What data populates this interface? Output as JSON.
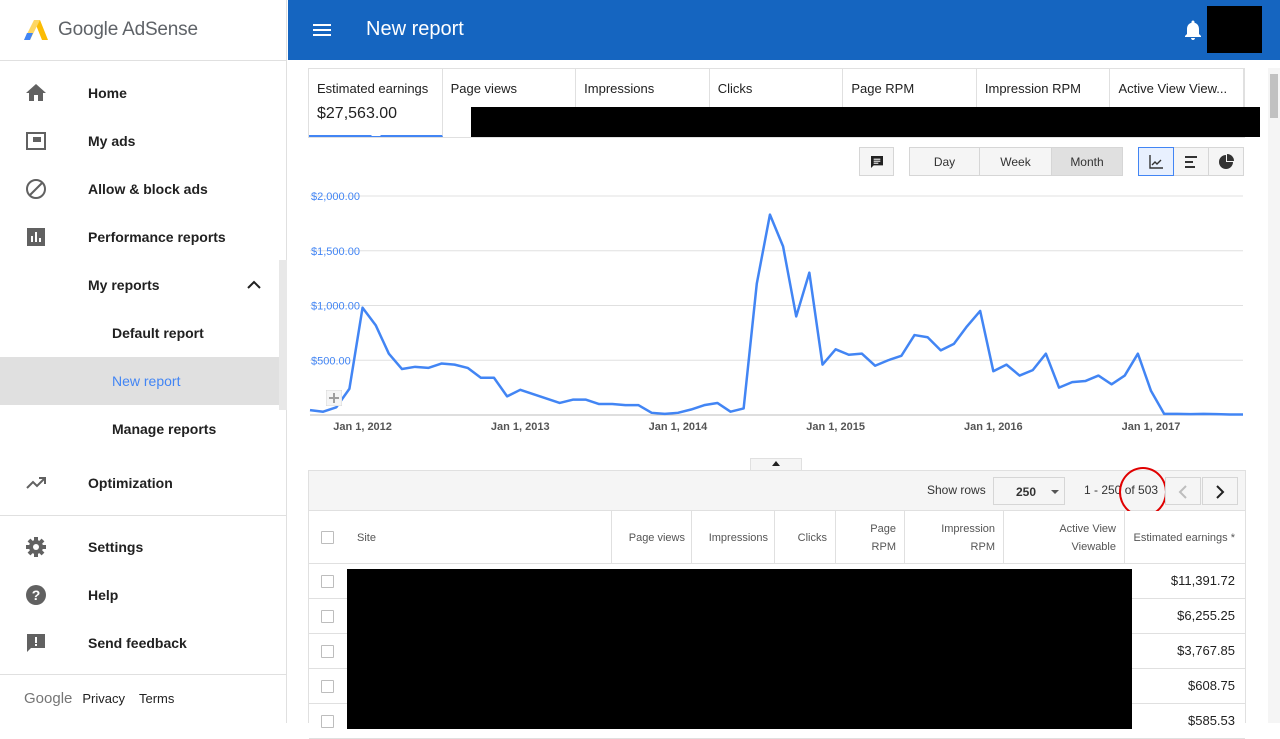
{
  "app": {
    "brand": "Google AdSense",
    "page_title": "New report",
    "colors": {
      "header": "#1565c0",
      "accent": "#4285f4",
      "active_nav_bg": "#e0e0e0"
    }
  },
  "sidebar": {
    "items": [
      {
        "label": "Home",
        "icon": "home-icon"
      },
      {
        "label": "My ads",
        "icon": "ad-unit-icon"
      },
      {
        "label": "Allow & block ads",
        "icon": "block-icon"
      },
      {
        "label": "Performance reports",
        "icon": "bar-chart-icon"
      },
      {
        "label": "My reports",
        "icon": "chevron-up-icon"
      },
      {
        "label": "Default report"
      },
      {
        "label": "New report",
        "active": true
      },
      {
        "label": "Manage reports"
      },
      {
        "label": "Optimization",
        "icon": "trending-up-icon"
      },
      {
        "label": "Settings",
        "icon": "gear-icon"
      },
      {
        "label": "Help",
        "icon": "help-icon"
      },
      {
        "label": "Send feedback",
        "icon": "feedback-icon"
      }
    ],
    "footer": {
      "google": "Google",
      "privacy": "Privacy",
      "terms": "Terms"
    }
  },
  "metrics": [
    {
      "label": "Estimated earnings",
      "value": "$27,563.00",
      "active": true
    },
    {
      "label": "Page views"
    },
    {
      "label": "Impressions"
    },
    {
      "label": "Clicks"
    },
    {
      "label": "Page RPM"
    },
    {
      "label": "Impression RPM"
    },
    {
      "label": "Active View View..."
    }
  ],
  "toolbar": {
    "comment_icon": "comment-icon",
    "periods": [
      "Day",
      "Week",
      "Month"
    ],
    "selected_period": "Month",
    "view_icons": [
      "line-chart-icon",
      "bar-chart-icon",
      "pie-chart-icon"
    ],
    "selected_view": "line-chart-icon"
  },
  "chart_data": {
    "type": "line",
    "title": "",
    "xlabel": "",
    "ylabel": "",
    "y_ticks": [
      "$2,000.00",
      "$1,500.00",
      "$1,000.00",
      "$500.00"
    ],
    "y_tick_values": [
      2000,
      1500,
      1000,
      500
    ],
    "ylim": [
      0,
      2000
    ],
    "x_ticks": [
      "Jan 1, 2012",
      "Jan 1, 2013",
      "Jan 1, 2014",
      "Jan 1, 2015",
      "Jan 1, 2016",
      "Jan 1, 2017"
    ],
    "x_tick_months": [
      4,
      16,
      28,
      40,
      52,
      64
    ],
    "x_range_months": [
      0,
      71
    ],
    "grid": true,
    "series": [
      {
        "color": "#4285f4",
        "values": [
          45,
          30,
          70,
          240,
          980,
          820,
          560,
          420,
          440,
          430,
          470,
          460,
          430,
          340,
          340,
          170,
          230,
          190,
          150,
          110,
          140,
          140,
          100,
          100,
          90,
          90,
          20,
          10,
          20,
          50,
          90,
          110,
          30,
          60,
          1200,
          1830,
          1540,
          900,
          1300,
          460,
          600,
          550,
          560,
          450,
          500,
          540,
          730,
          710,
          590,
          650,
          810,
          950,
          400,
          460,
          360,
          410,
          560,
          250,
          300,
          310,
          360,
          280,
          360,
          560,
          220,
          10,
          10,
          8,
          10,
          8,
          5,
          5
        ]
      }
    ]
  },
  "table": {
    "show_rows_label": "Show rows",
    "rows_value": "250",
    "page_info": "1 - 250 of 503",
    "columns": [
      "Site",
      "Page views",
      "Impressions",
      "Clicks",
      "Page RPM",
      "Impression RPM",
      "Active View Viewable",
      "Estimated earnings *"
    ],
    "rows": [
      {
        "earnings": "$11,391.72"
      },
      {
        "earnings": "$6,255.25"
      },
      {
        "earnings": "$3,767.85"
      },
      {
        "earnings": "$608.75"
      },
      {
        "earnings": "$585.53"
      }
    ]
  }
}
